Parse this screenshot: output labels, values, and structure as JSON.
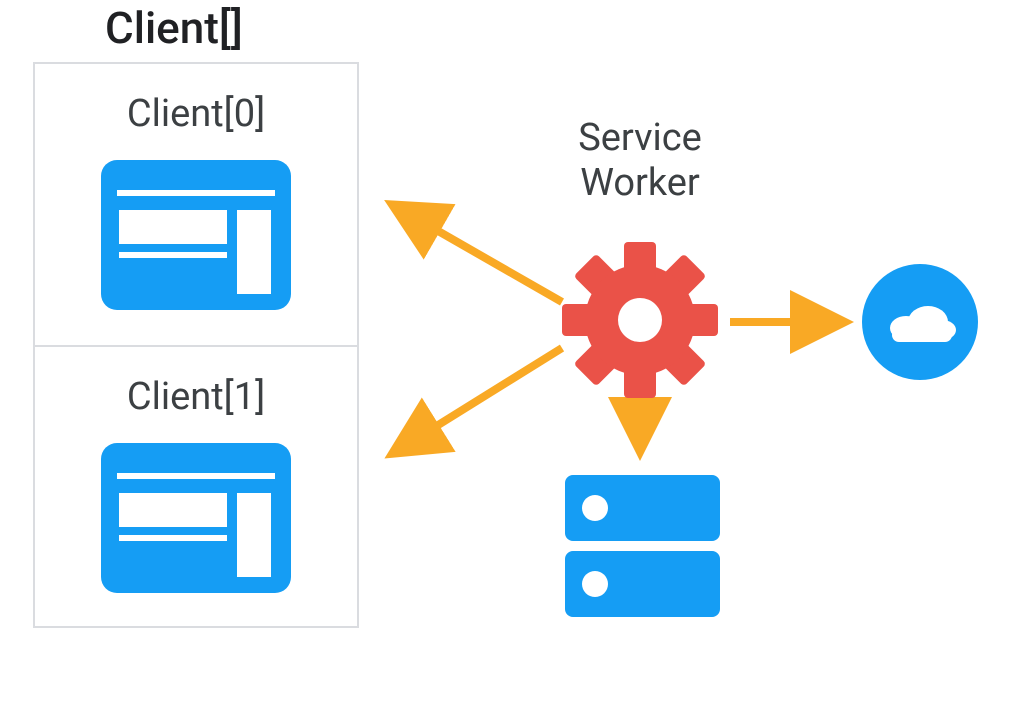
{
  "title": "Client[]",
  "clients": [
    {
      "label": "Client[0]"
    },
    {
      "label": "Client[1]"
    }
  ],
  "serviceWorker": {
    "label": "Service\nWorker"
  },
  "colors": {
    "blue": "#159df4",
    "red": "#ea5248",
    "orange": "#f9a925",
    "text": "#3c4043",
    "border": "#dadce0"
  },
  "nodes": [
    {
      "id": "client0",
      "type": "browser-window"
    },
    {
      "id": "client1",
      "type": "browser-window"
    },
    {
      "id": "service-worker",
      "type": "gear"
    },
    {
      "id": "cache",
      "type": "server"
    },
    {
      "id": "network",
      "type": "cloud"
    }
  ],
  "edges": [
    {
      "from": "service-worker",
      "to": "client0",
      "bidirectional": false
    },
    {
      "from": "service-worker",
      "to": "client1",
      "bidirectional": false
    },
    {
      "from": "service-worker",
      "to": "cache",
      "bidirectional": false
    },
    {
      "from": "service-worker",
      "to": "network",
      "bidirectional": false
    }
  ]
}
